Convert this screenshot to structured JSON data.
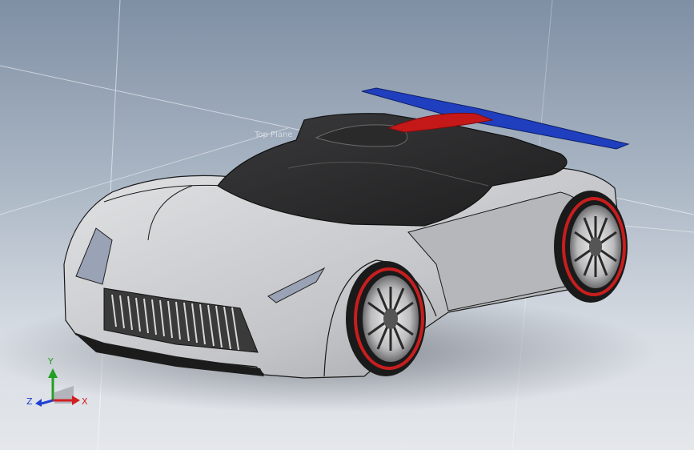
{
  "viewport": {
    "plane_label": "Top Plane"
  },
  "triad": {
    "x_label": "X",
    "y_label": "Y",
    "z_label": "Z",
    "x_color": "#d02020",
    "y_color": "#20a020",
    "z_color": "#2040d0"
  },
  "colors": {
    "body": "#c9cacc",
    "glass": "#2b2b2c",
    "spoiler": "#1f3fbf",
    "spoiler_fin": "#c51818",
    "rim": "#c81e1e"
  }
}
